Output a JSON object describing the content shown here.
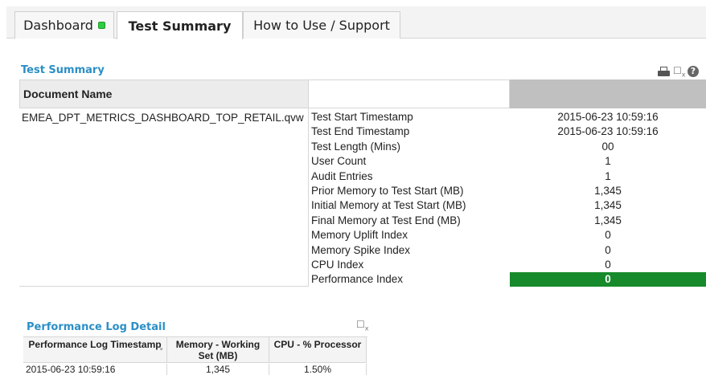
{
  "tabs": [
    {
      "label": "Dashboard",
      "status_color": "#2ecc40"
    },
    {
      "label": "Test Summary"
    },
    {
      "label": "How to Use / Support"
    }
  ],
  "summary": {
    "title": "Test Summary",
    "header": {
      "document_name": "Document Name"
    },
    "document": "EMEA_DPT_METRICS_DASHBOARD_TOP_RETAIL.qvw",
    "rows": [
      {
        "label": "Test Start Timestamp",
        "value": "2015-06-23 10:59:16"
      },
      {
        "label": "Test End Timestamp",
        "value": "2015-06-23 10:59:16"
      },
      {
        "label": "Test Length (Mins)",
        "value": "00"
      },
      {
        "label": "User Count",
        "value": "1"
      },
      {
        "label": "Audit Entries",
        "value": "1"
      },
      {
        "label": "Prior Memory to Test Start (MB)",
        "value": "1,345"
      },
      {
        "label": "Initial Memory at Test Start (MB)",
        "value": "1,345"
      },
      {
        "label": "Final Memory at Test End (MB)",
        "value": "1,345"
      },
      {
        "label": "Memory Uplift Index",
        "value": "0"
      },
      {
        "label": "Memory Spike Index",
        "value": "0"
      },
      {
        "label": "CPU Index",
        "value": "0"
      },
      {
        "label": "Performance Index",
        "value": "0"
      }
    ],
    "performance_color": "#178a2b",
    "icons": [
      "print-icon",
      "export-excel-icon",
      "help-icon"
    ]
  },
  "perf_log": {
    "title": "Performance Log Detail",
    "columns": [
      "Performance Log Timestamp",
      "Memory - Working Set (MB)",
      "CPU - % Processor"
    ],
    "rows": [
      [
        "2015-06-23 10:59:16",
        "1,345",
        "1.50%"
      ]
    ],
    "icons": [
      "export-excel-icon"
    ]
  },
  "colors": {
    "accent": "#2b8fc6",
    "header_gray": "#c0c0c0"
  }
}
